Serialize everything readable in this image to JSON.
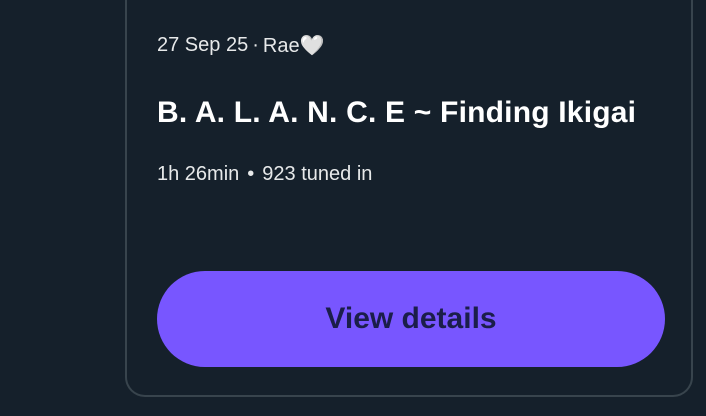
{
  "card": {
    "date": "27 Sep 25",
    "separator": "·",
    "host": "Rae🤍",
    "title": "B. A. L. A. N. C. E ~ Finding Ikigai",
    "duration": "1h 26min",
    "bullet": "•",
    "listeners": "923 tuned in",
    "button_label": "View details"
  },
  "colors": {
    "background": "#15202b",
    "card_border": "#38444d",
    "button_bg": "#7856ff",
    "button_text": "#1b1e4a"
  }
}
